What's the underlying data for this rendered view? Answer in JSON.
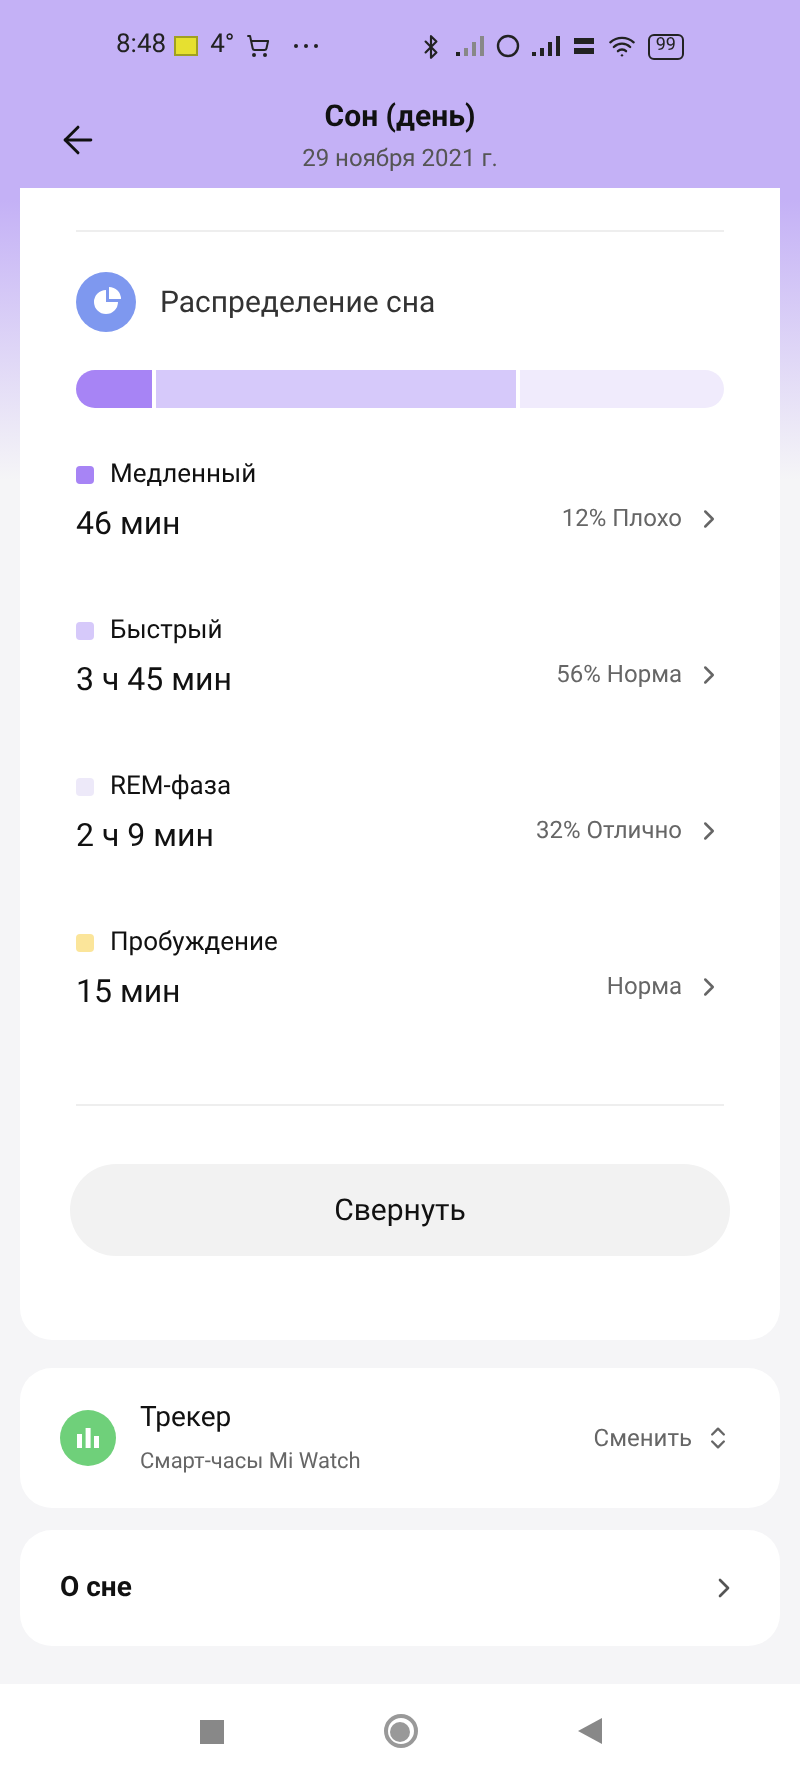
{
  "status_bar": {
    "time": "8:48",
    "temperature": "4°",
    "battery": "99"
  },
  "header": {
    "title": "Сон (день)",
    "subtitle": "29 ноября 2021 г."
  },
  "distribution": {
    "title": "Распределение сна",
    "segments": [
      {
        "color": "#a784f5"
      },
      {
        "color": "#d6c9fa"
      },
      {
        "color": "#f0ebfc"
      }
    ],
    "stages": [
      {
        "name": "Медленный",
        "color": "#a784f5",
        "duration": "46 мин",
        "rating": "12% Плохо"
      },
      {
        "name": "Быстрый",
        "color": "#d6c9fa",
        "duration": "3 ч 45 мин",
        "rating": "56% Норма"
      },
      {
        "name": "REM-фаза",
        "color": "#ede9f9",
        "duration": "2 ч 9 мин",
        "rating": "32% Отлично"
      },
      {
        "name": "Пробуждение",
        "color": "#fbe59a",
        "duration": "15 мин",
        "rating": "Норма"
      }
    ],
    "collapse_button": "Свернуть"
  },
  "tracker": {
    "title": "Трекер",
    "device": "Смарт-часы Mi Watch",
    "action": "Сменить"
  },
  "about": {
    "title": "О сне"
  }
}
